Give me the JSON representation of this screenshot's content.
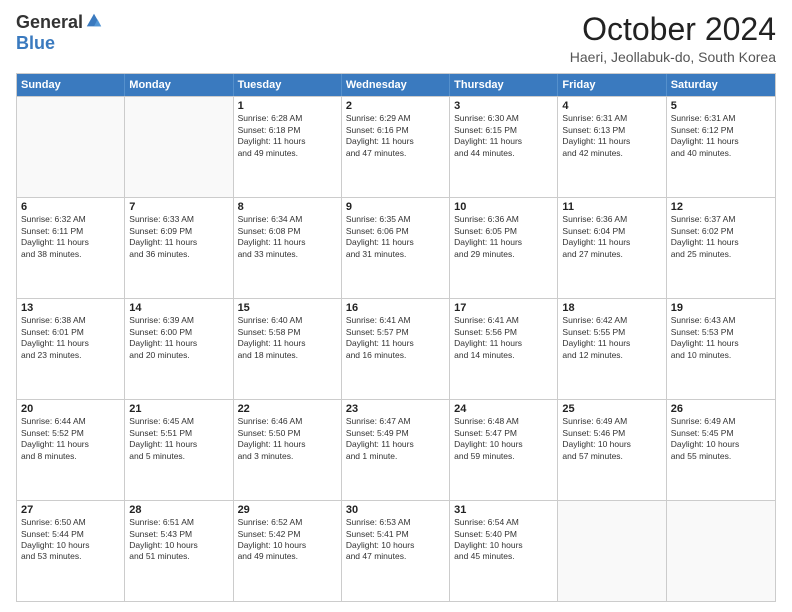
{
  "logo": {
    "general": "General",
    "blue": "Blue"
  },
  "header": {
    "month": "October 2024",
    "location": "Haeri, Jeollabuk-do, South Korea"
  },
  "weekdays": [
    "Sunday",
    "Monday",
    "Tuesday",
    "Wednesday",
    "Thursday",
    "Friday",
    "Saturday"
  ],
  "rows": [
    [
      {
        "day": "",
        "lines": []
      },
      {
        "day": "",
        "lines": []
      },
      {
        "day": "1",
        "lines": [
          "Sunrise: 6:28 AM",
          "Sunset: 6:18 PM",
          "Daylight: 11 hours",
          "and 49 minutes."
        ]
      },
      {
        "day": "2",
        "lines": [
          "Sunrise: 6:29 AM",
          "Sunset: 6:16 PM",
          "Daylight: 11 hours",
          "and 47 minutes."
        ]
      },
      {
        "day": "3",
        "lines": [
          "Sunrise: 6:30 AM",
          "Sunset: 6:15 PM",
          "Daylight: 11 hours",
          "and 44 minutes."
        ]
      },
      {
        "day": "4",
        "lines": [
          "Sunrise: 6:31 AM",
          "Sunset: 6:13 PM",
          "Daylight: 11 hours",
          "and 42 minutes."
        ]
      },
      {
        "day": "5",
        "lines": [
          "Sunrise: 6:31 AM",
          "Sunset: 6:12 PM",
          "Daylight: 11 hours",
          "and 40 minutes."
        ]
      }
    ],
    [
      {
        "day": "6",
        "lines": [
          "Sunrise: 6:32 AM",
          "Sunset: 6:11 PM",
          "Daylight: 11 hours",
          "and 38 minutes."
        ]
      },
      {
        "day": "7",
        "lines": [
          "Sunrise: 6:33 AM",
          "Sunset: 6:09 PM",
          "Daylight: 11 hours",
          "and 36 minutes."
        ]
      },
      {
        "day": "8",
        "lines": [
          "Sunrise: 6:34 AM",
          "Sunset: 6:08 PM",
          "Daylight: 11 hours",
          "and 33 minutes."
        ]
      },
      {
        "day": "9",
        "lines": [
          "Sunrise: 6:35 AM",
          "Sunset: 6:06 PM",
          "Daylight: 11 hours",
          "and 31 minutes."
        ]
      },
      {
        "day": "10",
        "lines": [
          "Sunrise: 6:36 AM",
          "Sunset: 6:05 PM",
          "Daylight: 11 hours",
          "and 29 minutes."
        ]
      },
      {
        "day": "11",
        "lines": [
          "Sunrise: 6:36 AM",
          "Sunset: 6:04 PM",
          "Daylight: 11 hours",
          "and 27 minutes."
        ]
      },
      {
        "day": "12",
        "lines": [
          "Sunrise: 6:37 AM",
          "Sunset: 6:02 PM",
          "Daylight: 11 hours",
          "and 25 minutes."
        ]
      }
    ],
    [
      {
        "day": "13",
        "lines": [
          "Sunrise: 6:38 AM",
          "Sunset: 6:01 PM",
          "Daylight: 11 hours",
          "and 23 minutes."
        ]
      },
      {
        "day": "14",
        "lines": [
          "Sunrise: 6:39 AM",
          "Sunset: 6:00 PM",
          "Daylight: 11 hours",
          "and 20 minutes."
        ]
      },
      {
        "day": "15",
        "lines": [
          "Sunrise: 6:40 AM",
          "Sunset: 5:58 PM",
          "Daylight: 11 hours",
          "and 18 minutes."
        ]
      },
      {
        "day": "16",
        "lines": [
          "Sunrise: 6:41 AM",
          "Sunset: 5:57 PM",
          "Daylight: 11 hours",
          "and 16 minutes."
        ]
      },
      {
        "day": "17",
        "lines": [
          "Sunrise: 6:41 AM",
          "Sunset: 5:56 PM",
          "Daylight: 11 hours",
          "and 14 minutes."
        ]
      },
      {
        "day": "18",
        "lines": [
          "Sunrise: 6:42 AM",
          "Sunset: 5:55 PM",
          "Daylight: 11 hours",
          "and 12 minutes."
        ]
      },
      {
        "day": "19",
        "lines": [
          "Sunrise: 6:43 AM",
          "Sunset: 5:53 PM",
          "Daylight: 11 hours",
          "and 10 minutes."
        ]
      }
    ],
    [
      {
        "day": "20",
        "lines": [
          "Sunrise: 6:44 AM",
          "Sunset: 5:52 PM",
          "Daylight: 11 hours",
          "and 8 minutes."
        ]
      },
      {
        "day": "21",
        "lines": [
          "Sunrise: 6:45 AM",
          "Sunset: 5:51 PM",
          "Daylight: 11 hours",
          "and 5 minutes."
        ]
      },
      {
        "day": "22",
        "lines": [
          "Sunrise: 6:46 AM",
          "Sunset: 5:50 PM",
          "Daylight: 11 hours",
          "and 3 minutes."
        ]
      },
      {
        "day": "23",
        "lines": [
          "Sunrise: 6:47 AM",
          "Sunset: 5:49 PM",
          "Daylight: 11 hours",
          "and 1 minute."
        ]
      },
      {
        "day": "24",
        "lines": [
          "Sunrise: 6:48 AM",
          "Sunset: 5:47 PM",
          "Daylight: 10 hours",
          "and 59 minutes."
        ]
      },
      {
        "day": "25",
        "lines": [
          "Sunrise: 6:49 AM",
          "Sunset: 5:46 PM",
          "Daylight: 10 hours",
          "and 57 minutes."
        ]
      },
      {
        "day": "26",
        "lines": [
          "Sunrise: 6:49 AM",
          "Sunset: 5:45 PM",
          "Daylight: 10 hours",
          "and 55 minutes."
        ]
      }
    ],
    [
      {
        "day": "27",
        "lines": [
          "Sunrise: 6:50 AM",
          "Sunset: 5:44 PM",
          "Daylight: 10 hours",
          "and 53 minutes."
        ]
      },
      {
        "day": "28",
        "lines": [
          "Sunrise: 6:51 AM",
          "Sunset: 5:43 PM",
          "Daylight: 10 hours",
          "and 51 minutes."
        ]
      },
      {
        "day": "29",
        "lines": [
          "Sunrise: 6:52 AM",
          "Sunset: 5:42 PM",
          "Daylight: 10 hours",
          "and 49 minutes."
        ]
      },
      {
        "day": "30",
        "lines": [
          "Sunrise: 6:53 AM",
          "Sunset: 5:41 PM",
          "Daylight: 10 hours",
          "and 47 minutes."
        ]
      },
      {
        "day": "31",
        "lines": [
          "Sunrise: 6:54 AM",
          "Sunset: 5:40 PM",
          "Daylight: 10 hours",
          "and 45 minutes."
        ]
      },
      {
        "day": "",
        "lines": []
      },
      {
        "day": "",
        "lines": []
      }
    ]
  ]
}
